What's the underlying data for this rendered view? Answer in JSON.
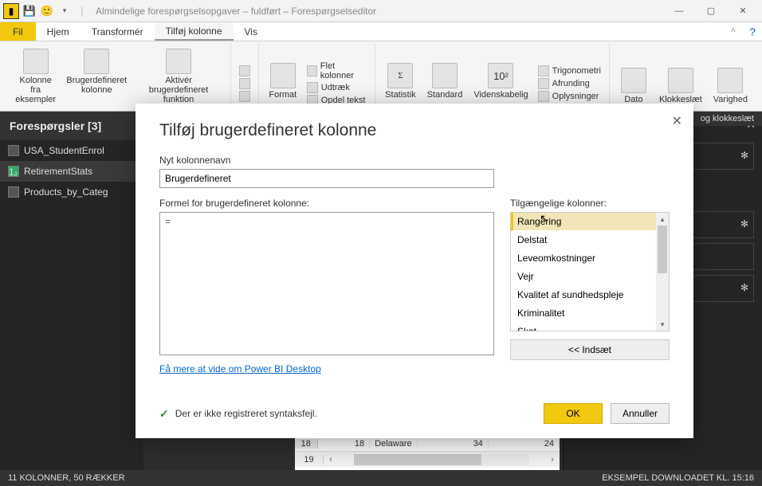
{
  "titlebar": {
    "text": "Almindelige forespørgselsopgaver – fuldført – Forespørgselseditor"
  },
  "menu": {
    "file": "Fil",
    "home": "Hjem",
    "transform": "Transformér",
    "addcol": "Tilføj kolonne",
    "view": "Vis"
  },
  "ribbon": {
    "col_from_examples": "Kolonne fra\neksempler",
    "custom_col": "Brugerdefineret\nkolonne",
    "invoke_fn": "Aktivér brugerdefineret\nfunktion",
    "format": "Format",
    "merge_cols": "Flet kolonner",
    "extract": "Udtræk",
    "split_text": "Opdel tekst",
    "statistics": "Statistik",
    "standard": "Standard",
    "scientific": "Videnskabelig",
    "trig": "Trigonometri",
    "rounding": "Afrunding",
    "info": "Oplysninger",
    "date": "Dato",
    "time": "Klokkeslæt",
    "duration": "Varighed",
    "group_date": "og klokkeslæt"
  },
  "queries": {
    "header": "Forespørgsler [3]",
    "items": [
      "USA_StudentEnrol",
      "RetirementStats",
      "Products_by_Categ"
    ]
  },
  "settings": {
    "gear": "✻"
  },
  "table": {
    "row": {
      "num_left": "18",
      "num": "18",
      "state": "Delaware",
      "v1": "34",
      "v2": "24"
    },
    "row2_num": "19"
  },
  "status": {
    "left": "11 KOLONNER, 50 RÆKKER",
    "right": "EKSEMPEL DOWNLOADET KL. 15:16"
  },
  "dialog": {
    "title": "Tilføj brugerdefineret kolonne",
    "newcol_label": "Nyt kolonnenavn",
    "newcol_value": "Brugerdefineret",
    "formula_label": "Formel for brugerdefineret kolonne:",
    "formula_value": "=",
    "avail_label": "Tilgængelige kolonner:",
    "avail": [
      "Rangering",
      "Delstat",
      "Leveomkostninger",
      "Vejr",
      "Kvalitet af sundhedspleje",
      "Kriminalitet",
      "Skat"
    ],
    "insert": "<< Indsæt",
    "learn": "Få mere at vide om Power BI Desktop",
    "syntax": "Der er ikke registreret syntaksfejl.",
    "ok": "OK",
    "cancel": "Annuller"
  }
}
